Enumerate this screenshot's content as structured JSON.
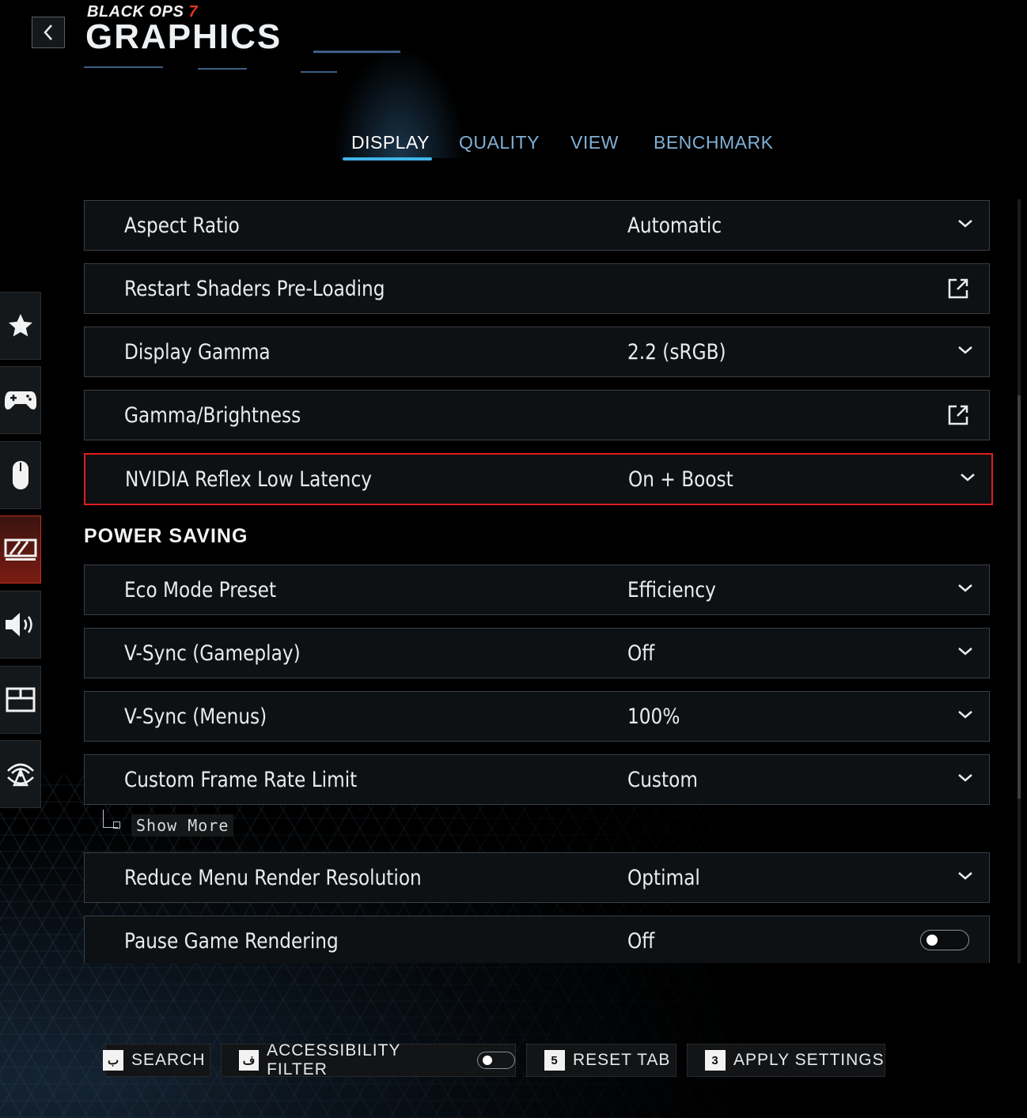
{
  "header": {
    "game_logo_main": "BLACK OPS",
    "game_logo_number": "7",
    "title": "GRAPHICS"
  },
  "tabs": [
    {
      "label": "DISPLAY",
      "active": true
    },
    {
      "label": "QUALITY",
      "active": false
    },
    {
      "label": "VIEW",
      "active": false
    },
    {
      "label": "BENCHMARK",
      "active": false
    }
  ],
  "side_nav": [
    {
      "icon": "star-icon",
      "active": false
    },
    {
      "icon": "controller-icon",
      "active": false
    },
    {
      "icon": "mouse-icon",
      "active": false
    },
    {
      "icon": "graphics-icon",
      "active": true
    },
    {
      "icon": "speaker-icon",
      "active": false
    },
    {
      "icon": "interface-icon",
      "active": false
    },
    {
      "icon": "network-icon",
      "active": false
    }
  ],
  "settings": [
    {
      "label": "Aspect Ratio",
      "value": "Automatic",
      "control": "dropdown"
    },
    {
      "label": "Restart Shaders Pre-Loading",
      "value": "",
      "control": "external"
    },
    {
      "label": "Display Gamma",
      "value": "2.2 (sRGB)",
      "control": "dropdown"
    },
    {
      "label": "Gamma/Brightness",
      "value": "",
      "control": "external"
    },
    {
      "label": "NVIDIA Reflex Low Latency",
      "value": "On + Boost",
      "control": "dropdown",
      "highlighted": true
    }
  ],
  "power_saving": {
    "title": "POWER SAVING",
    "settings": [
      {
        "label": "Eco Mode Preset",
        "value": "Efficiency",
        "control": "dropdown"
      },
      {
        "label": "V-Sync (Gameplay)",
        "value": "Off",
        "control": "dropdown"
      },
      {
        "label": "V-Sync (Menus)",
        "value": "100%",
        "control": "dropdown"
      },
      {
        "label": "Custom Frame Rate Limit",
        "value": "Custom",
        "control": "dropdown"
      }
    ],
    "show_more": "Show More",
    "settings_after": [
      {
        "label": "Reduce Menu Render Resolution",
        "value": "Optimal",
        "control": "dropdown"
      },
      {
        "label": "Pause Game Rendering",
        "value": "Off",
        "control": "toggle",
        "toggle_on": false
      }
    ]
  },
  "footer": {
    "search": {
      "key": "ب",
      "label": "SEARCH"
    },
    "accessibility": {
      "key": "ف",
      "label": "ACCESSIBILITY FILTER",
      "toggle_on": false
    },
    "reset": {
      "key": "5",
      "label": "RESET TAB"
    },
    "apply": {
      "key": "3",
      "label": "APPLY SETTINGS"
    }
  },
  "colors": {
    "accent_blue": "#3fb6e8",
    "tab_inactive": "#7fb0d6",
    "highlight_red": "#e01d1d",
    "active_nav_red": "#c2301f"
  }
}
